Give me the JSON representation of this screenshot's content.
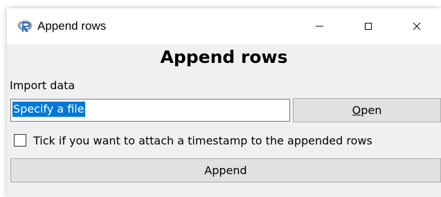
{
  "window": {
    "title": "Append rows",
    "app_icon": "r-logo-icon",
    "controls": {
      "minimize_icon": "minimize-icon",
      "maximize_icon": "maximize-icon",
      "close_icon": "close-icon"
    }
  },
  "main": {
    "heading": "Append rows",
    "import_label": "Import data",
    "file_input": {
      "value": "Specify a file"
    },
    "open_button": {
      "label_underlined": "O",
      "label_rest": "pen"
    },
    "timestamp_checkbox": {
      "checked": false,
      "label": "Tick if you want to attach a timestamp to the appended rows"
    },
    "append_button": {
      "label": "Append"
    }
  },
  "colors": {
    "selection": "#0078d7",
    "window_bg": "#f0f0f0",
    "button_bg": "#e1e1e1",
    "r_logo_blue": "#2266b8",
    "r_logo_gray": "#9ea2a8"
  }
}
